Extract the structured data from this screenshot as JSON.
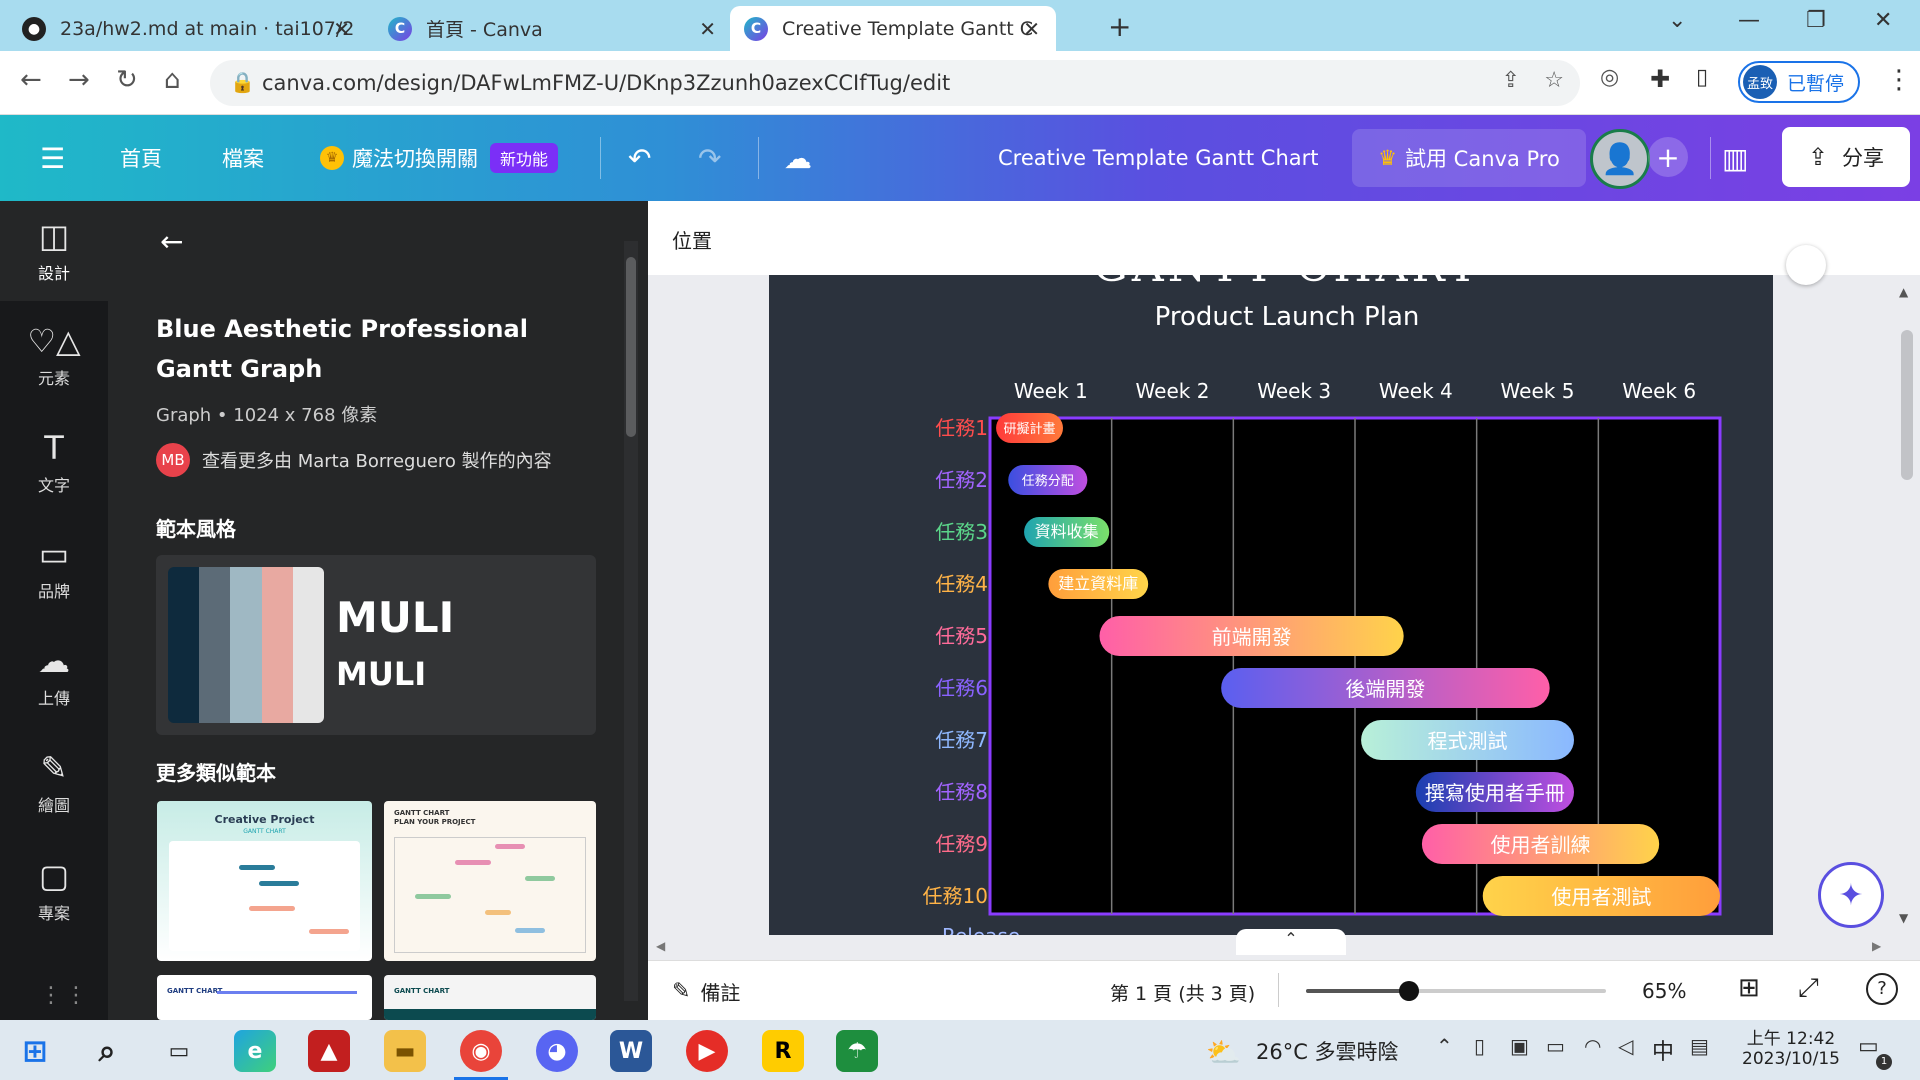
{
  "browser": {
    "tabs": [
      {
        "title": "23a/hw2.md at main · tai107/2",
        "icon": "github-icon"
      },
      {
        "title": "首頁 - Canva",
        "icon": "canva-icon"
      },
      {
        "title": "Creative Template Gantt Chart",
        "icon": "canva-icon"
      }
    ],
    "url": "canva.com/design/DAFwLmFMZ-U/DKnp3Zzunh0azexCCIfTug/edit",
    "profile_initials": "孟致",
    "profile_status": "已暫停"
  },
  "canva_header": {
    "home": "首頁",
    "file": "檔案",
    "magic_switch": "魔法切換開關",
    "new_badge": "新功能",
    "doc_title": "Creative Template Gantt Chart",
    "try_pro": "試用 Canva Pro",
    "share": "分享"
  },
  "rail": [
    {
      "label": "設計",
      "icon": "design-icon"
    },
    {
      "label": "元素",
      "icon": "elements-icon"
    },
    {
      "label": "文字",
      "icon": "text-icon"
    },
    {
      "label": "品牌",
      "icon": "brand-icon"
    },
    {
      "label": "上傳",
      "icon": "upload-icon"
    },
    {
      "label": "繪圖",
      "icon": "draw-icon"
    },
    {
      "label": "專案",
      "icon": "projects-icon"
    }
  ],
  "panel": {
    "title": "Blue Aesthetic Professional Gantt Graph",
    "meta": "Graph • 1024 x 768 像素",
    "author_initials": "MB",
    "author_text": "查看更多由 Marta Borreguero 製作的內容",
    "style_heading": "範本風格",
    "font_name_1": "MULI",
    "font_name_2": "MULI",
    "palette": [
      "#0e2a3d",
      "#5c6b77",
      "#9fb8c3",
      "#e8a9a1",
      "#e6e6e6"
    ],
    "more_heading": "更多類似範本",
    "thumb1_title": "Creative Project",
    "thumb1_sub": "GANTT CHART",
    "thumb2_title": "GANTT CHART\nPLAN YOUR PROJECT",
    "thumb3_title": "GANTT CHART",
    "thumb4_title": "GANTT CHART"
  },
  "editor": {
    "position_label": "位置",
    "notes_label": "備註",
    "page_info": "第 1 頁 (共 3 頁)",
    "zoom": "65%",
    "zoom_fraction": 0.65
  },
  "chart_data": {
    "type": "gantt",
    "title": "GANTT CHART",
    "subtitle": "Product Launch Plan",
    "weeks": [
      "Week 1",
      "Week 2",
      "Week 3",
      "Week 4",
      "Week 5",
      "Week 6"
    ],
    "tasks": [
      {
        "row": "任務1",
        "label": "研擬計畫",
        "start": 0.05,
        "end": 0.6,
        "label_color": "#ff4d4d",
        "grad": [
          "#ff3b3b",
          "#ff7a3b"
        ]
      },
      {
        "row": "任務2",
        "label": "任務分配",
        "start": 0.15,
        "end": 0.8,
        "label_color": "#a264ff",
        "grad": [
          "#3b4fe0",
          "#c04fe0"
        ]
      },
      {
        "row": "任務3",
        "label": "資料收集",
        "start": 0.28,
        "end": 0.98,
        "label_color": "#5bd68a",
        "grad": [
          "#1fa4b0",
          "#7be06a"
        ]
      },
      {
        "row": "任務4",
        "label": "建立資料庫",
        "start": 0.48,
        "end": 1.3,
        "label_color": "#ffb347",
        "grad": [
          "#ff9e3b",
          "#ffd54a"
        ]
      },
      {
        "row": "任務5",
        "label": "前端開發",
        "start": 0.9,
        "end": 3.4,
        "label_color": "#ff6b9a",
        "grad": [
          "#ff5fa8",
          "#ffd34a"
        ]
      },
      {
        "row": "任務6",
        "label": "後端開發",
        "start": 1.9,
        "end": 4.6,
        "label_color": "#8a63ff",
        "grad": [
          "#5a5ff0",
          "#ff5fa8"
        ]
      },
      {
        "row": "任務7",
        "label": "程式測試",
        "start": 3.05,
        "end": 4.8,
        "label_color": "#8fb8ff",
        "grad": [
          "#b8f0d8",
          "#8ab8ff"
        ]
      },
      {
        "row": "任務8",
        "label": "撰寫使用者手冊",
        "start": 3.5,
        "end": 4.8,
        "label_color": "#a264ff",
        "grad": [
          "#1a3fb0",
          "#c04fe0"
        ]
      },
      {
        "row": "任務9",
        "label": "使用者訓練",
        "start": 3.55,
        "end": 5.5,
        "label_color": "#ff6b8a",
        "grad": [
          "#ff5fa8",
          "#ffd34a"
        ]
      },
      {
        "row": "任務10",
        "label": "使用者測試",
        "start": 4.05,
        "end": 6.0,
        "label_color": "#ffb347",
        "grad": [
          "#ffd34a",
          "#ff9e3b"
        ]
      }
    ],
    "footer_label": "Release"
  },
  "taskbar": {
    "weather": "26°C 多雲時陰",
    "ime": "中",
    "time": "上午 12:42",
    "date": "2023/10/15",
    "notifications": "1"
  }
}
